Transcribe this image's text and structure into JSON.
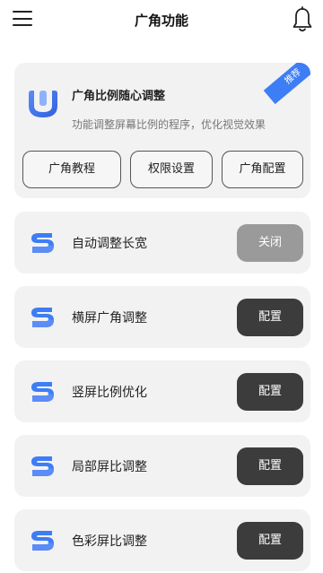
{
  "header": {
    "title": "广角功能",
    "menu_icon": "hamburger-menu-icon",
    "bell_icon": "bell-icon"
  },
  "feature_card": {
    "badge": "推荐",
    "title": "广角比例随心调整",
    "description": "功能调整屏幕比例的程序，优化视觉效果",
    "buttons": [
      "广角教程",
      "权限设置",
      "广角配置"
    ]
  },
  "rows": [
    {
      "label": "自动调整长宽",
      "button": "关闭",
      "state": "off"
    },
    {
      "label": "横屏广角调整",
      "button": "配置",
      "state": "on"
    },
    {
      "label": "竖屏比例优化",
      "button": "配置",
      "state": "on"
    },
    {
      "label": "局部屏比调整",
      "button": "配置",
      "state": "on"
    },
    {
      "label": "色彩屏比调整",
      "button": "配置",
      "state": "on"
    }
  ],
  "colors": {
    "accent_blue": "#3d7df5",
    "dark_button": "#3c3c3c",
    "disabled_button": "#9a9a9a",
    "card_bg": "#f2f2f2"
  }
}
